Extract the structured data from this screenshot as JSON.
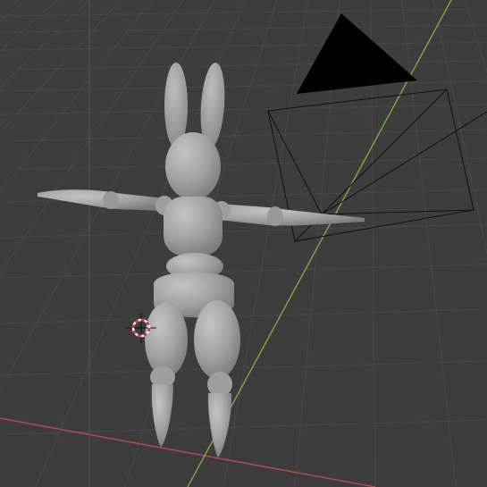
{
  "viewport": {
    "background": "#3d3d3d",
    "grid_color": "#4a4a4a",
    "x_axis_color": "#b14a52",
    "y_axis_color": "#7aa33d"
  },
  "scene": {
    "objects": [
      {
        "id": "rabbit-figure",
        "type": "mesh",
        "color": "#9e9e9e"
      },
      {
        "id": "camera",
        "type": "camera",
        "color": "#000000"
      },
      {
        "id": "3d-cursor",
        "type": "cursor",
        "colors": [
          "#d33b3b",
          "#ffffff"
        ]
      }
    ]
  }
}
